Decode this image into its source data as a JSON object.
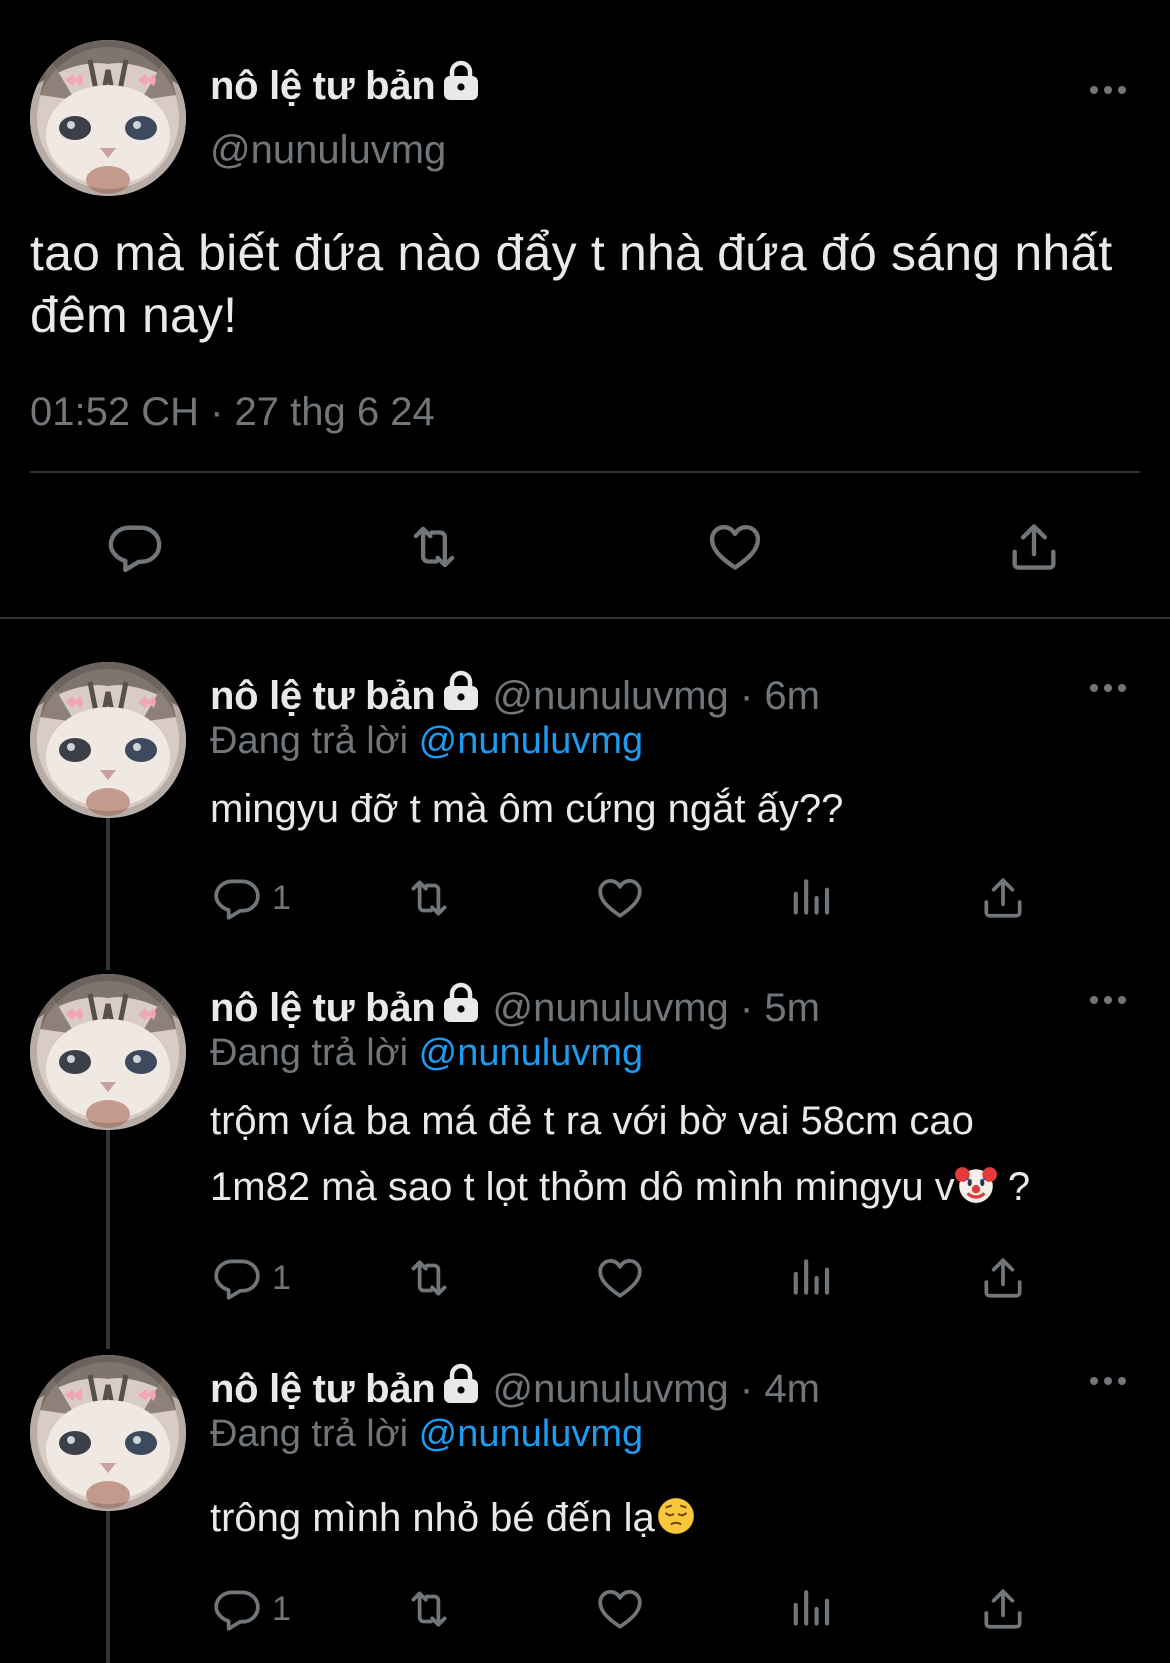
{
  "main_tweet": {
    "display_name": "nô lệ tư bản",
    "handle": "@nunuluvmg",
    "text": "tao mà biết đứa nào đẩy t nhà đứa đó sáng nhất đêm nay!",
    "timestamp": "01:52 CH · 27 thg 6 24"
  },
  "replies": [
    {
      "display_name": "nô lệ tư bản",
      "handle": "@nunuluvmg",
      "time": "6m",
      "replying_prefix": "Đang trả lời",
      "replying_to": "@nunuluvmg",
      "text": "mingyu đỡ t mà ôm cứng ngắt ấy??",
      "reply_count": "1"
    },
    {
      "display_name": "nô lệ tư bản",
      "handle": "@nunuluvmg",
      "time": "5m",
      "replying_prefix": "Đang trả lời",
      "replying_to": "@nunuluvmg",
      "text_line1": "trộm vía ba má đẻ t ra với bờ vai 58cm cao",
      "text_line2": "1m82 mà sao t lọt thỏm dô mình mingyu v",
      "text_end": " ?",
      "emoji": "clown-face-emoji",
      "reply_count": "1"
    },
    {
      "display_name": "nô lệ tư bản",
      "handle": "@nunuluvmg",
      "time": "4m",
      "replying_prefix": "Đang trả lời",
      "replying_to": "@nunuluvmg",
      "text": "trông mình nhỏ bé đến lạ",
      "emoji": "pensive-face-emoji",
      "reply_count": "1"
    }
  ],
  "colors": {
    "background": "#000000",
    "text": "#e7e9ea",
    "secondary": "#71767b",
    "link": "#1d9bf0",
    "divider": "#2f3336"
  },
  "icons": [
    "lock-icon",
    "more-icon",
    "reply-icon",
    "retweet-icon",
    "like-icon",
    "views-icon",
    "share-icon"
  ]
}
